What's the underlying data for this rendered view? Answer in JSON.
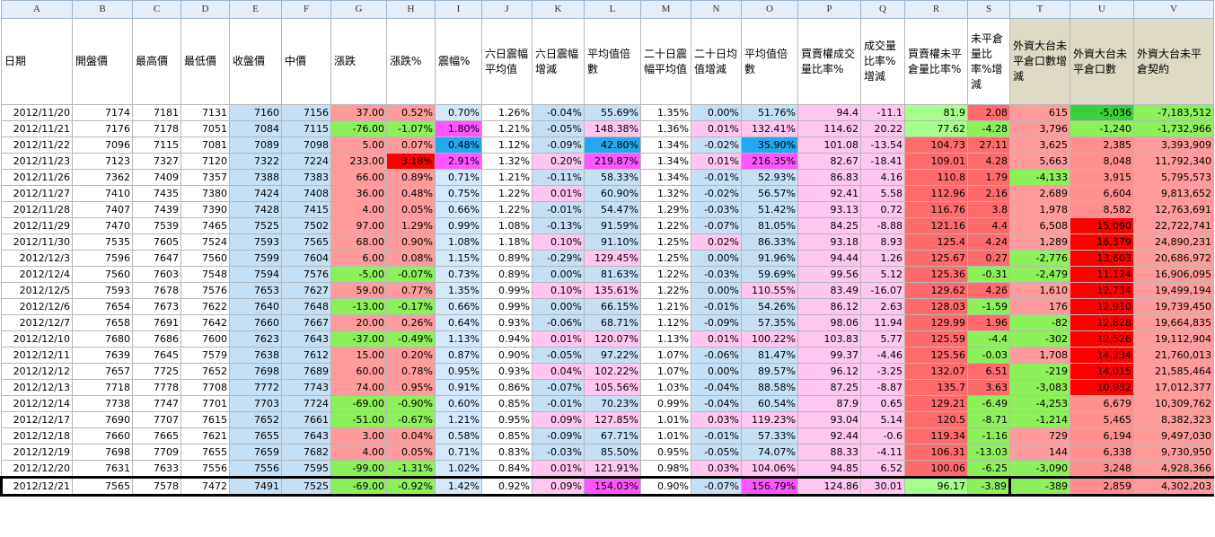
{
  "columns": [
    "A",
    "B",
    "C",
    "D",
    "E",
    "F",
    "G",
    "H",
    "I",
    "J",
    "K",
    "L",
    "M",
    "N",
    "O",
    "P",
    "Q",
    "R",
    "S",
    "T",
    "U",
    "V"
  ],
  "headers": [
    "日期",
    "開盤價",
    "最高價",
    "最低價",
    "收盤價",
    "中價",
    "漲跌",
    "漲跌%",
    "震幅%",
    "六日震幅平均值",
    "六日震幅增減",
    "平均值倍數",
    "二十日震幅平均值",
    "二十日均值增減",
    "平均值倍數",
    "買賣權成交量比率%",
    "成交量比率%增減",
    "買賣權未平倉量比率%",
    "未平倉量比率%增減",
    "外資大台未平倉口數增減",
    "外資大台未平倉口數",
    "外資大台未平倉契約"
  ],
  "rows": [
    [
      "2012/11/20",
      "7174",
      "7181",
      "7131",
      "7160",
      "7156",
      "37.00",
      "0.52%",
      "0.70%",
      "1.26%",
      "-0.04%",
      "55.69%",
      "1.35%",
      "0.00%",
      "51.76%",
      "94.4",
      "-11.1",
      "81.9",
      "2.08",
      "615",
      "-5,036",
      "-7,183,512"
    ],
    [
      "2012/11/21",
      "7176",
      "7178",
      "7051",
      "7084",
      "7115",
      "-76.00",
      "-1.07%",
      "1.80%",
      "1.21%",
      "-0.05%",
      "148.38%",
      "1.36%",
      "0.01%",
      "132.41%",
      "114.62",
      "20.22",
      "77.62",
      "-4.28",
      "3,796",
      "-1,240",
      "-1,732,966"
    ],
    [
      "2012/11/22",
      "7096",
      "7115",
      "7081",
      "7089",
      "7098",
      "5.00",
      "0.07%",
      "0.48%",
      "1.12%",
      "-0.09%",
      "42.80%",
      "1.34%",
      "-0.02%",
      "35.90%",
      "101.08",
      "-13.54",
      "104.73",
      "27.11",
      "3,625",
      "2,385",
      "3,393,909"
    ],
    [
      "2012/11/23",
      "7123",
      "7327",
      "7120",
      "7322",
      "7224",
      "233.00",
      "3.18%",
      "2.91%",
      "1.32%",
      "0.20%",
      "219.87%",
      "1.34%",
      "0.01%",
      "216.35%",
      "82.67",
      "-18.41",
      "109.01",
      "4.28",
      "5,663",
      "8,048",
      "11,792,340"
    ],
    [
      "2012/11/26",
      "7362",
      "7409",
      "7357",
      "7388",
      "7383",
      "66.00",
      "0.89%",
      "0.71%",
      "1.21%",
      "-0.11%",
      "58.33%",
      "1.34%",
      "-0.01%",
      "52.93%",
      "86.83",
      "4.16",
      "110.8",
      "1.79",
      "-4,133",
      "3,915",
      "5,795,573"
    ],
    [
      "2012/11/27",
      "7410",
      "7435",
      "7380",
      "7424",
      "7408",
      "36.00",
      "0.48%",
      "0.75%",
      "1.22%",
      "0.01%",
      "60.90%",
      "1.32%",
      "-0.02%",
      "56.57%",
      "92.41",
      "5.58",
      "112.96",
      "2.16",
      "2,689",
      "6,604",
      "9,813,652"
    ],
    [
      "2012/11/28",
      "7407",
      "7439",
      "7390",
      "7428",
      "7415",
      "4.00",
      "0.05%",
      "0.66%",
      "1.22%",
      "-0.01%",
      "54.47%",
      "1.29%",
      "-0.03%",
      "51.42%",
      "93.13",
      "0.72",
      "116.76",
      "3.8",
      "1,978",
      "8,582",
      "12,763,691"
    ],
    [
      "2012/11/29",
      "7470",
      "7539",
      "7465",
      "7525",
      "7502",
      "97.00",
      "1.29%",
      "0.99%",
      "1.08%",
      "-0.13%",
      "91.59%",
      "1.22%",
      "-0.07%",
      "81.05%",
      "84.25",
      "-8.88",
      "121.16",
      "4.4",
      "6,508",
      "15,090",
      "22,722,741"
    ],
    [
      "2012/11/30",
      "7535",
      "7605",
      "7524",
      "7593",
      "7565",
      "68.00",
      "0.90%",
      "1.08%",
      "1.18%",
      "0.10%",
      "91.10%",
      "1.25%",
      "0.02%",
      "86.33%",
      "93.18",
      "8.93",
      "125.4",
      "4.24",
      "1,289",
      "16,379",
      "24,890,231"
    ],
    [
      "2012/12/3",
      "7596",
      "7647",
      "7560",
      "7599",
      "7604",
      "6.00",
      "0.08%",
      "1.15%",
      "0.89%",
      "-0.29%",
      "129.45%",
      "1.25%",
      "0.00%",
      "91.96%",
      "94.44",
      "1.26",
      "125.67",
      "0.27",
      "-2,776",
      "13,603",
      "20,686,972"
    ],
    [
      "2012/12/4",
      "7560",
      "7603",
      "7548",
      "7594",
      "7576",
      "-5.00",
      "-0.07%",
      "0.73%",
      "0.89%",
      "0.00%",
      "81.63%",
      "1.22%",
      "-0.03%",
      "59.69%",
      "99.56",
      "5.12",
      "125.36",
      "-0.31",
      "-2,479",
      "11,124",
      "16,906,095"
    ],
    [
      "2012/12/5",
      "7593",
      "7678",
      "7576",
      "7653",
      "7627",
      "59.00",
      "0.77%",
      "1.35%",
      "0.99%",
      "0.10%",
      "135.61%",
      "1.22%",
      "0.00%",
      "110.55%",
      "83.49",
      "-16.07",
      "129.62",
      "4.26",
      "1,610",
      "12,734",
      "19,499,194"
    ],
    [
      "2012/12/6",
      "7654",
      "7673",
      "7622",
      "7640",
      "7648",
      "-13.00",
      "-0.17%",
      "0.66%",
      "0.99%",
      "0.00%",
      "66.15%",
      "1.21%",
      "-0.01%",
      "54.26%",
      "86.12",
      "2.63",
      "128.03",
      "-1.59",
      "176",
      "12,910",
      "19,739,450"
    ],
    [
      "2012/12/7",
      "7658",
      "7691",
      "7642",
      "7660",
      "7667",
      "20.00",
      "0.26%",
      "0.64%",
      "0.93%",
      "-0.06%",
      "68.71%",
      "1.12%",
      "-0.09%",
      "57.35%",
      "98.06",
      "11.94",
      "129.99",
      "1.96",
      "-82",
      "12,828",
      "19,664,835"
    ],
    [
      "2012/12/10",
      "7680",
      "7686",
      "7600",
      "7623",
      "7643",
      "-37.00",
      "-0.49%",
      "1.13%",
      "0.94%",
      "0.01%",
      "120.07%",
      "1.13%",
      "0.01%",
      "100.22%",
      "103.83",
      "5.77",
      "125.59",
      "-4.4",
      "-302",
      "12,526",
      "19,112,904"
    ],
    [
      "2012/12/11",
      "7639",
      "7645",
      "7579",
      "7638",
      "7612",
      "15.00",
      "0.20%",
      "0.87%",
      "0.90%",
      "-0.05%",
      "97.22%",
      "1.07%",
      "-0.06%",
      "81.47%",
      "99.37",
      "-4.46",
      "125.56",
      "-0.03",
      "1,708",
      "14,234",
      "21,760,013"
    ],
    [
      "2012/12/12",
      "7657",
      "7725",
      "7652",
      "7698",
      "7689",
      "60.00",
      "0.78%",
      "0.95%",
      "0.93%",
      "0.04%",
      "102.22%",
      "1.07%",
      "0.00%",
      "89.57%",
      "96.12",
      "-3.25",
      "132.07",
      "6.51",
      "-219",
      "14,015",
      "21,585,464"
    ],
    [
      "2012/12/13",
      "7718",
      "7778",
      "7708",
      "7772",
      "7743",
      "74.00",
      "0.95%",
      "0.91%",
      "0.86%",
      "-0.07%",
      "105.56%",
      "1.03%",
      "-0.04%",
      "88.58%",
      "87.25",
      "-8.87",
      "135.7",
      "3.63",
      "-3,083",
      "10,932",
      "17,012,377"
    ],
    [
      "2012/12/14",
      "7738",
      "7747",
      "7701",
      "7703",
      "7724",
      "-69.00",
      "-0.90%",
      "0.60%",
      "0.85%",
      "-0.01%",
      "70.23%",
      "0.99%",
      "-0.04%",
      "60.54%",
      "87.9",
      "0.65",
      "129.21",
      "-6.49",
      "-4,253",
      "6,679",
      "10,309,762"
    ],
    [
      "2012/12/17",
      "7690",
      "7707",
      "7615",
      "7652",
      "7661",
      "-51.00",
      "-0.67%",
      "1.21%",
      "0.95%",
      "0.09%",
      "127.85%",
      "1.01%",
      "0.03%",
      "119.23%",
      "93.04",
      "5.14",
      "120.5",
      "-8.71",
      "-1,214",
      "5,465",
      "8,382,323"
    ],
    [
      "2012/12/18",
      "7660",
      "7665",
      "7621",
      "7655",
      "7643",
      "3.00",
      "0.04%",
      "0.58%",
      "0.85%",
      "-0.09%",
      "67.71%",
      "1.01%",
      "-0.01%",
      "57.33%",
      "92.44",
      "-0.6",
      "119.34",
      "-1.16",
      "729",
      "6,194",
      "9,497,030"
    ],
    [
      "2012/12/19",
      "7698",
      "7709",
      "7655",
      "7659",
      "7682",
      "4.00",
      "0.05%",
      "0.71%",
      "0.83%",
      "-0.03%",
      "85.50%",
      "0.95%",
      "-0.05%",
      "74.07%",
      "88.33",
      "-4.11",
      "106.31",
      "-13.03",
      "144",
      "6,338",
      "9,730,950"
    ],
    [
      "2012/12/20",
      "7631",
      "7633",
      "7556",
      "7556",
      "7595",
      "-99.00",
      "-1.31%",
      "1.02%",
      "0.84%",
      "0.01%",
      "121.91%",
      "0.98%",
      "0.03%",
      "104.06%",
      "94.85",
      "6.52",
      "100.06",
      "-6.25",
      "-3,090",
      "3,248",
      "4,928,366"
    ],
    [
      "2012/12/21",
      "7565",
      "7578",
      "7472",
      "7491",
      "7525",
      "-69.00",
      "-0.92%",
      "1.42%",
      "0.92%",
      "0.09%",
      "154.03%",
      "0.90%",
      "-0.07%",
      "156.79%",
      "124.86",
      "30.01",
      "96.17",
      "-3.89",
      "-389",
      "2,859",
      "4,302,203"
    ]
  ],
  "colors": {
    "blue": "#c5e0f5",
    "red": "#ff9b9b",
    "bright_red": "#ff0000",
    "green": "#8cf05a",
    "dark_green": "#3ccf3c",
    "pink": "#ffc6f0",
    "magenta": "#ff55ff",
    "cyan": "#22a7f0",
    "header_tan": "#dedac6",
    "column_header": "#e4ecf7"
  }
}
